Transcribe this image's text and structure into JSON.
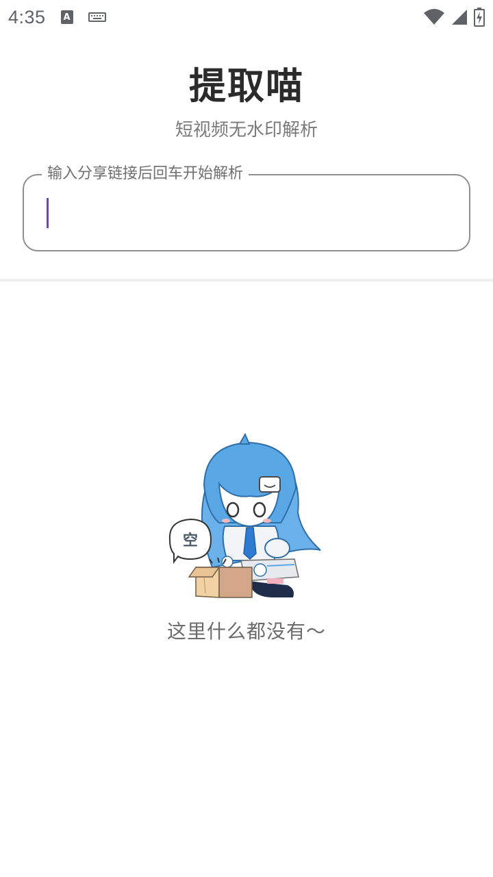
{
  "status_bar": {
    "time": "4:35",
    "icons": [
      "a-notification-icon",
      "keyboard-icon",
      "wifi-icon",
      "signal-icon",
      "battery-charging-icon"
    ]
  },
  "header": {
    "title": "提取喵",
    "subtitle": "短视频无水印解析"
  },
  "search": {
    "label": "输入分享链接后回车开始解析",
    "value": ""
  },
  "empty_state": {
    "bubble_text": "空",
    "message": "这里什么都没有～"
  },
  "colors": {
    "cursor": "#6b4aa8",
    "hair": "#5aa7e6",
    "box": "#d9b48a"
  }
}
